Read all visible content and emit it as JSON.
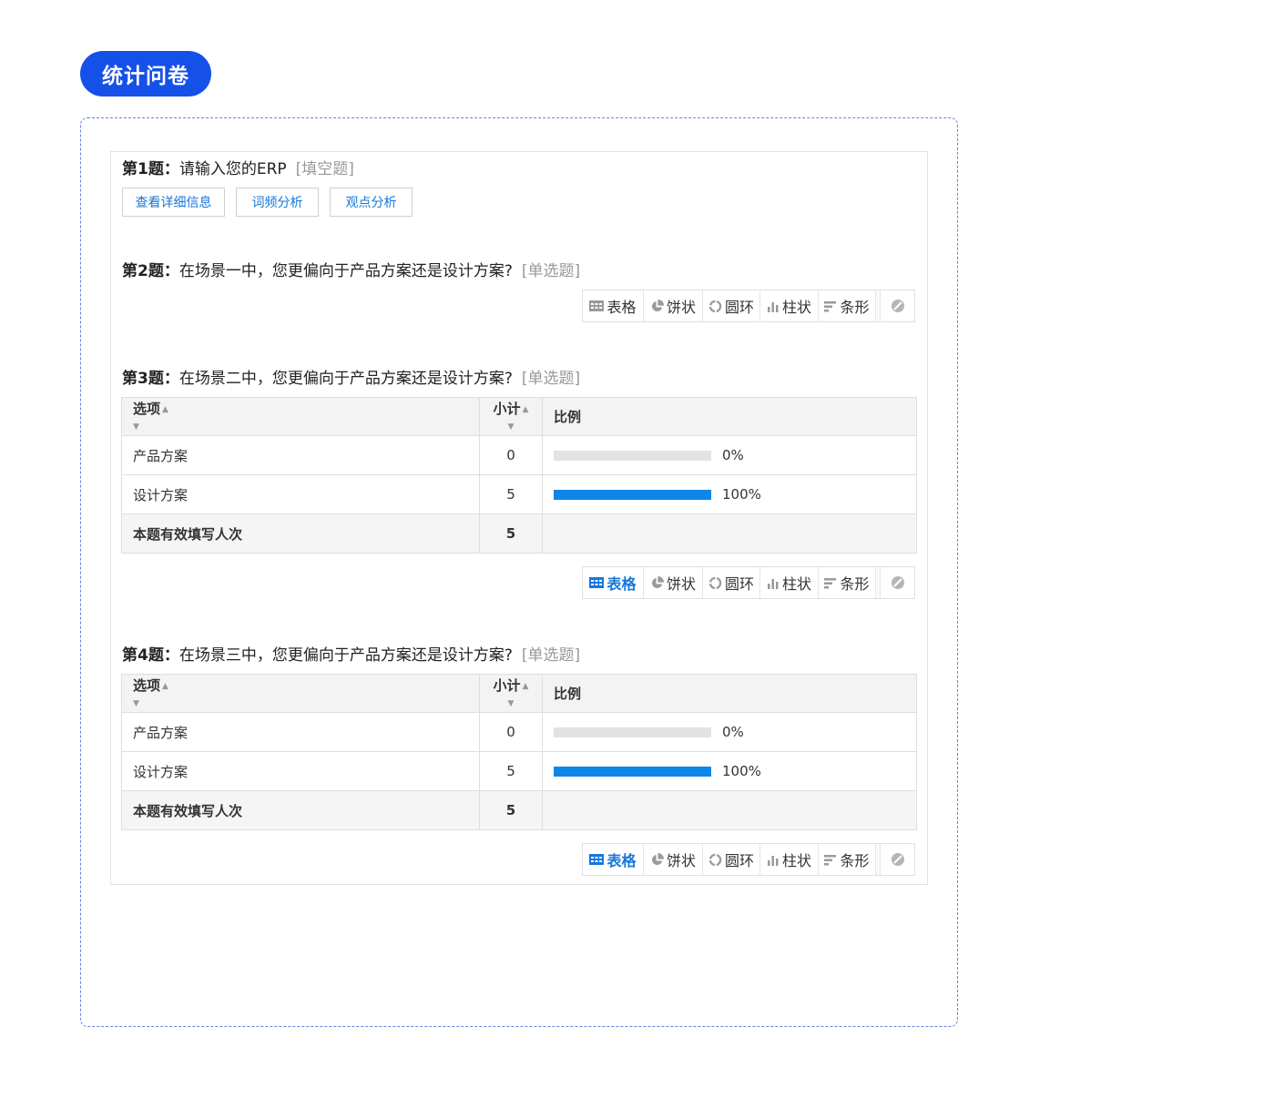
{
  "header": {
    "title": "统计问卷"
  },
  "questions": [
    {
      "num": "第1题：",
      "text": "请输入您的ERP",
      "type": "[填空题]",
      "buttons": [
        "查看详细信息",
        "词频分析",
        "观点分析"
      ]
    },
    {
      "num": "第2题：",
      "text": "在场景一中，您更偏向于产品方案还是设计方案?",
      "type": "[单选题]"
    },
    {
      "num": "第3题：",
      "text": "在场景二中，您更偏向于产品方案还是设计方案?",
      "type": "[单选题]",
      "rows": [
        {
          "option": "产品方案",
          "count": "0",
          "ratio": "0%",
          "fraction": 0
        },
        {
          "option": "设计方案",
          "count": "5",
          "ratio": "100%",
          "fraction": 1
        }
      ],
      "total": {
        "label": "本题有效填写人次",
        "count": "5"
      }
    },
    {
      "num": "第4题：",
      "text": "在场景三中，您更偏向于产品方案还是设计方案?",
      "type": "[单选题]",
      "rows": [
        {
          "option": "产品方案",
          "count": "0",
          "ratio": "0%",
          "fraction": 0
        },
        {
          "option": "设计方案",
          "count": "5",
          "ratio": "100%",
          "fraction": 1
        }
      ],
      "total": {
        "label": "本题有效填写人次",
        "count": "5"
      }
    }
  ],
  "table_headers": {
    "option": "选项",
    "count": "小计",
    "ratio": "比例"
  },
  "view_modes": {
    "table": "表格",
    "pie": "饼状",
    "ring": "圆环",
    "column": "柱状",
    "bar": "条形"
  },
  "colors": {
    "accent": "#1550e8",
    "link": "#1677d9",
    "bar_fill": "#0e86e8",
    "bar_track": "#e2e2e2"
  }
}
